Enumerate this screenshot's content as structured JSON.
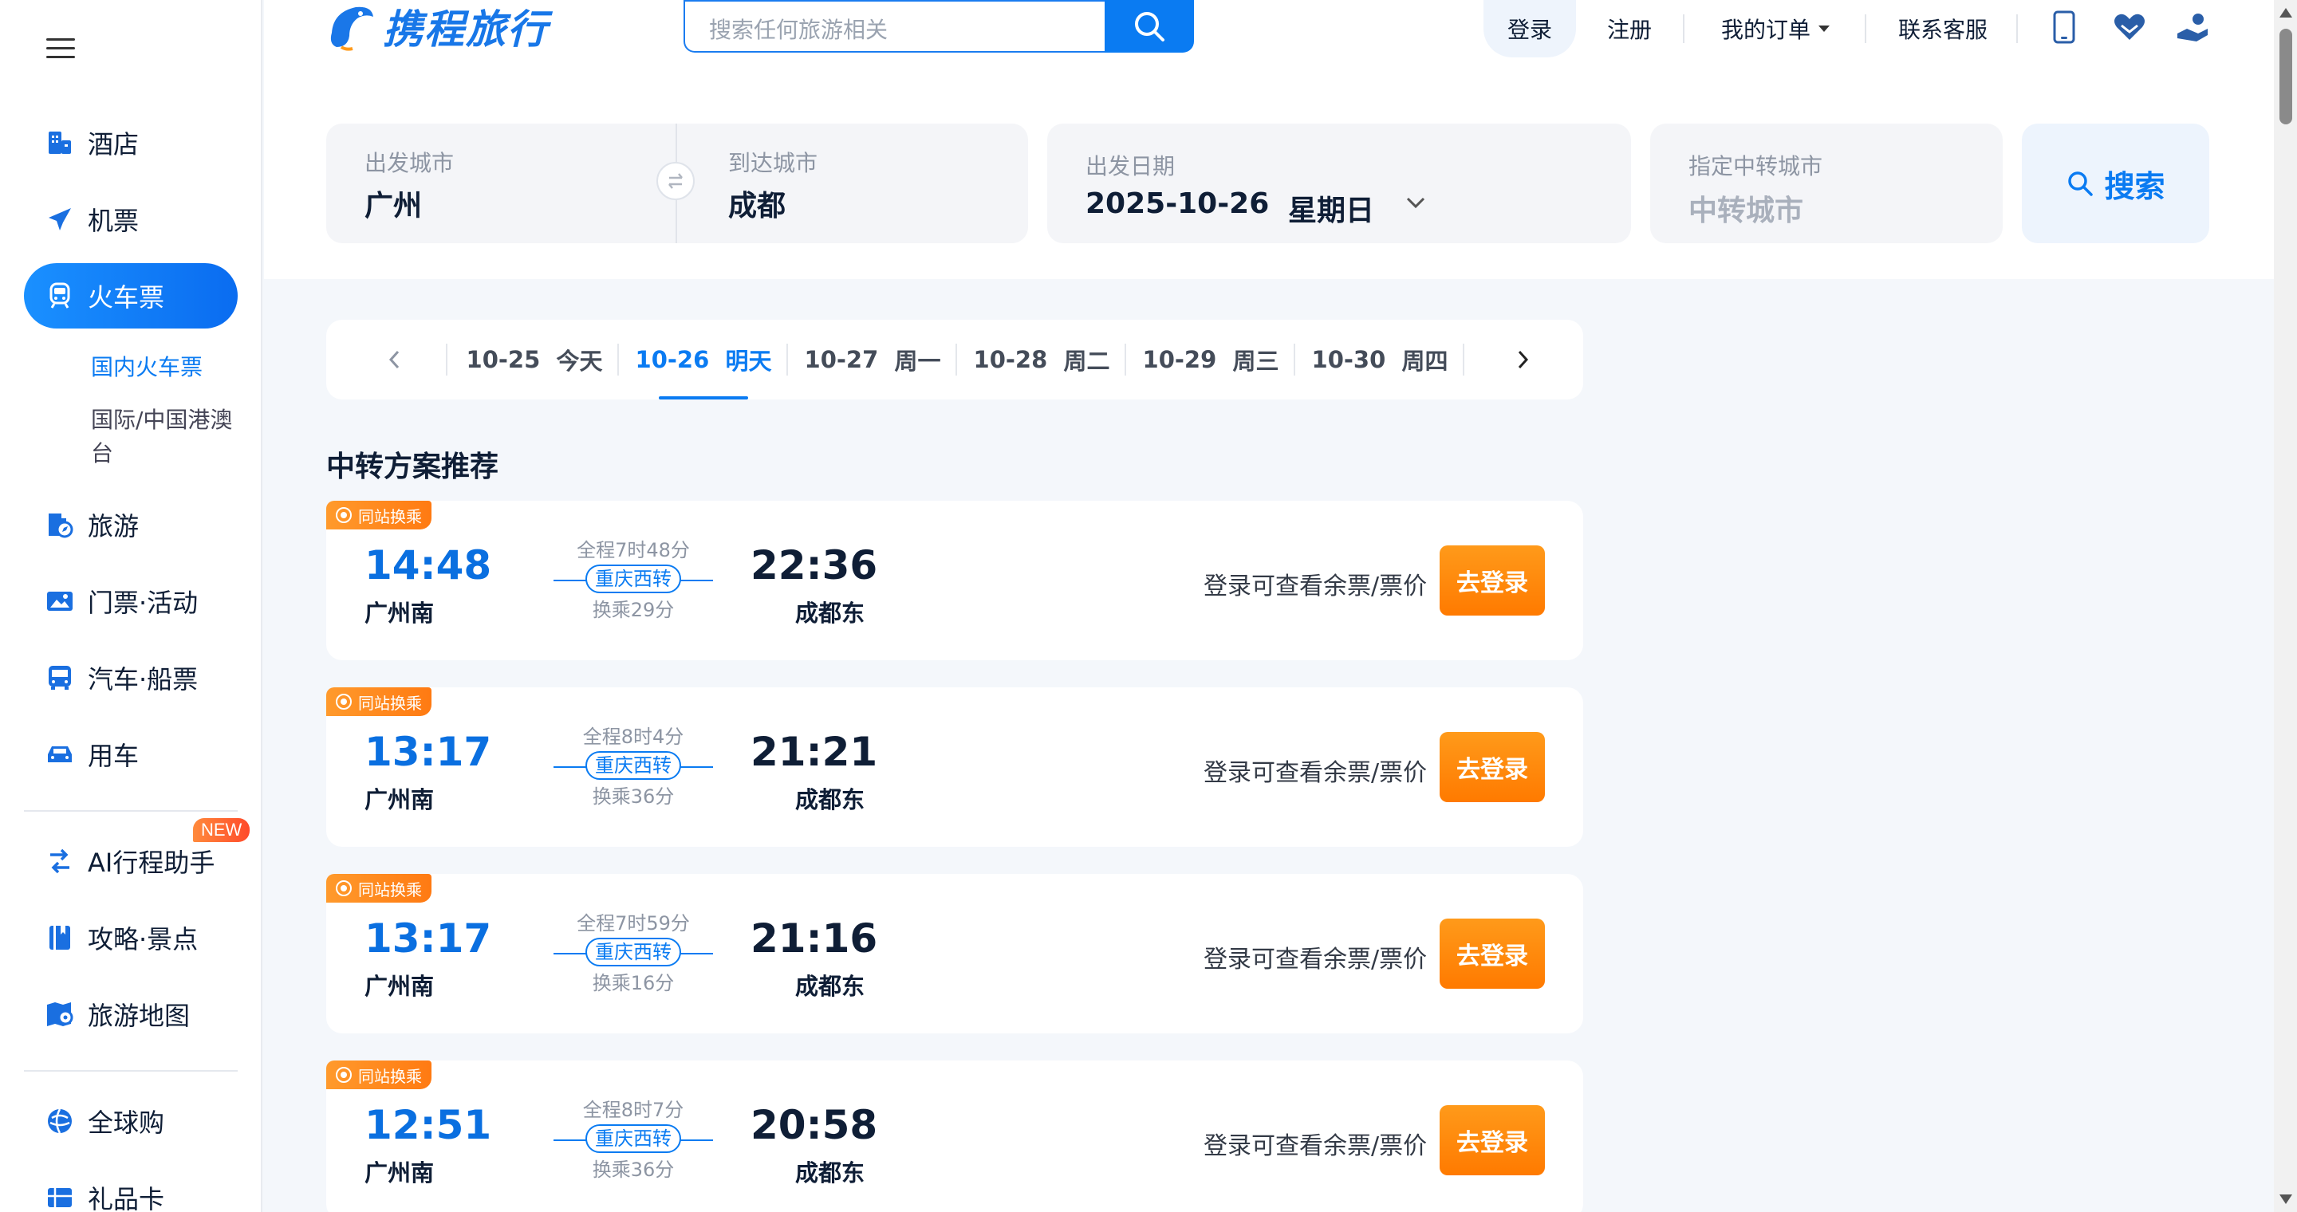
{
  "brand": {
    "logo_text": "携程旅行",
    "accent": "#0a7bf2",
    "orange": "#ff8a00"
  },
  "header": {
    "search_placeholder": "搜索任何旅游相关",
    "login": "登录",
    "register": "注册",
    "my_orders": "我的订单",
    "contact": "联系客服",
    "icons": [
      "phone-icon",
      "heart-hands-icon",
      "user-service-icon"
    ]
  },
  "sidebar": {
    "items": [
      {
        "label": "酒店",
        "icon": "hotel-icon"
      },
      {
        "label": "机票",
        "icon": "plane-icon"
      },
      {
        "label": "火车票",
        "icon": "train-icon"
      },
      {
        "label": "旅游",
        "icon": "travel-icon"
      },
      {
        "label": "门票·活动",
        "icon": "ticket-icon"
      },
      {
        "label": "汽车·船票",
        "icon": "bus-icon"
      },
      {
        "label": "用车",
        "icon": "car-icon"
      },
      {
        "label": "AI行程助手",
        "icon": "ai-assistant-icon"
      },
      {
        "label": "攻略·景点",
        "icon": "guide-icon"
      },
      {
        "label": "旅游地图",
        "icon": "map-icon"
      },
      {
        "label": "全球购",
        "icon": "global-shopping-icon"
      },
      {
        "label": "礼品卡",
        "icon": "gift-card-icon"
      }
    ],
    "sub_items": [
      "国内火车票",
      "国际/中国港澳台"
    ],
    "new_badge": "NEW"
  },
  "search_form": {
    "from_label": "出发城市",
    "from_value": "广州",
    "to_label": "到达城市",
    "to_value": "成都",
    "date_label": "出发日期",
    "date_value": "2025-10-26",
    "weekday": "星期日",
    "transfer_label": "指定中转城市",
    "transfer_placeholder": "中转城市",
    "search_button": "搜索"
  },
  "date_tabs": [
    {
      "date": "10-25",
      "day": "今天"
    },
    {
      "date": "10-26",
      "day": "明天"
    },
    {
      "date": "10-27",
      "day": "周一"
    },
    {
      "date": "10-28",
      "day": "周二"
    },
    {
      "date": "10-29",
      "day": "周三"
    },
    {
      "date": "10-30",
      "day": "周四"
    }
  ],
  "section_title": "中转方案推荐",
  "results": [
    {
      "badge": "同站换乘",
      "dep_time": "14:48",
      "dep_station": "广州南",
      "duration": "全程7时48分",
      "via": "重庆西转",
      "transfer": "换乘29分",
      "arr_time": "22:36",
      "arr_station": "成都东",
      "hint": "登录可查看余票/票价",
      "button": "去登录"
    },
    {
      "badge": "同站换乘",
      "dep_time": "13:17",
      "dep_station": "广州南",
      "duration": "全程8时4分",
      "via": "重庆西转",
      "transfer": "换乘36分",
      "arr_time": "21:21",
      "arr_station": "成都东",
      "hint": "登录可查看余票/票价",
      "button": "去登录"
    },
    {
      "badge": "同站换乘",
      "dep_time": "13:17",
      "dep_station": "广州南",
      "duration": "全程7时59分",
      "via": "重庆西转",
      "transfer": "换乘16分",
      "arr_time": "21:16",
      "arr_station": "成都东",
      "hint": "登录可查看余票/票价",
      "button": "去登录"
    },
    {
      "badge": "同站换乘",
      "dep_time": "12:51",
      "dep_station": "广州南",
      "duration": "全程8时7分",
      "via": "重庆西转",
      "transfer": "换乘36分",
      "arr_time": "20:58",
      "arr_station": "成都东",
      "hint": "登录可查看余票/票价",
      "button": "去登录"
    }
  ]
}
